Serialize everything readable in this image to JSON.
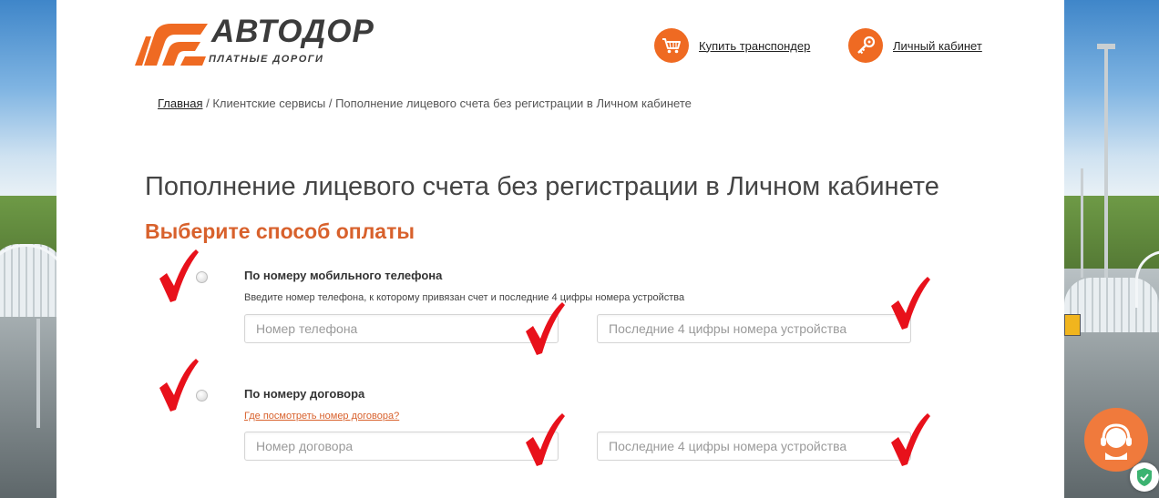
{
  "brand": {
    "name": "АВТОДОР",
    "tagline": "ПЛАТНЫЕ ДОРОГИ",
    "accent": "#ef6a22"
  },
  "header": {
    "links": [
      {
        "label": "Купить транспондер",
        "icon": "cart-icon"
      },
      {
        "label": "Личный кабинет",
        "icon": "key-icon"
      }
    ]
  },
  "breadcrumb": {
    "home": "Главная",
    "separator": " / ",
    "section": "Клиентские сервисы",
    "current": "Пополнение лицевого счета без регистрации в Личном кабинете"
  },
  "page": {
    "title": "Пополнение лицевого счета без регистрации в Личном кабинете",
    "subtitle": "Выберите способ оплаты"
  },
  "options": [
    {
      "title": "По номеру мобильного телефона",
      "hint": "Введите номер телефона, к которому привязан счет и последние 4 цифры номера устройства",
      "field1_placeholder": "Номер телефона",
      "field2_placeholder": "Последние 4 цифры номера устройства",
      "selected": false
    },
    {
      "title": "По номеру договора",
      "hint_link": "Где посмотреть номер договора?",
      "field1_placeholder": "Номер договора",
      "field2_placeholder": "Последние 4 цифры номера устройства",
      "selected": false
    }
  ],
  "annotation_color": "#e8111b"
}
